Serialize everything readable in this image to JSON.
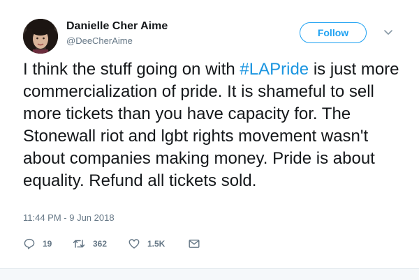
{
  "author": {
    "name": "Danielle Cher Aime",
    "handle": "@DeeCherAime"
  },
  "follow_label": "Follow",
  "tweet": {
    "text_before": "I think the stuff going on with ",
    "hashtag": "#LAPride",
    "text_after": " is just more commercialization of pride. It is shameful to sell more tickets than you have capacity for. The Stonewall riot and lgbt rights movement wasn't about companies making money. Pride is about equality. Refund all tickets sold."
  },
  "timestamp": "11:44 PM - 9 Jun 2018",
  "actions": {
    "replies": "19",
    "retweets": "362",
    "likes": "1.5K"
  },
  "colors": {
    "accent": "#1da1f2",
    "hashtag": "#1b95e0",
    "muted": "#657786",
    "text": "#14171a"
  },
  "icons": [
    "caret-down-icon",
    "reply-icon",
    "retweet-icon",
    "heart-icon",
    "envelope-icon"
  ]
}
